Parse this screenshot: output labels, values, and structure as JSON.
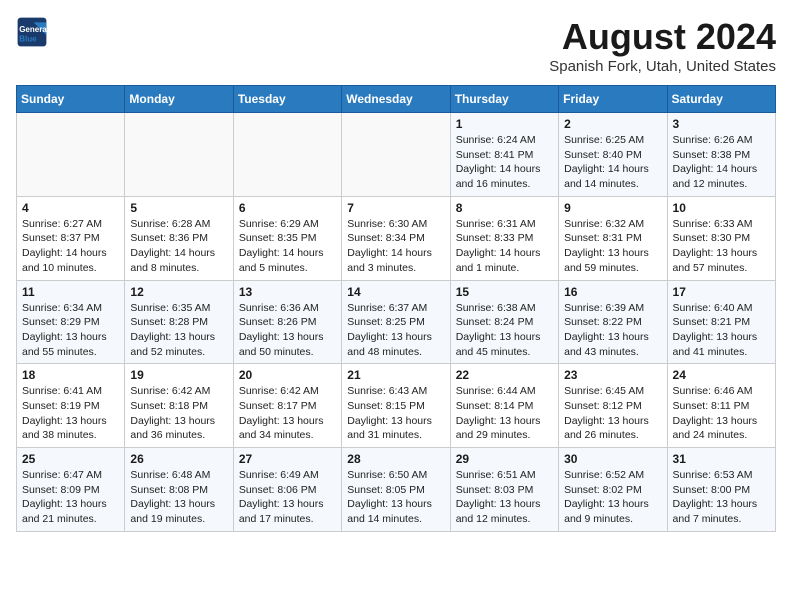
{
  "header": {
    "logo_line1": "General",
    "logo_line2": "Blue",
    "title": "August 2024",
    "subtitle": "Spanish Fork, Utah, United States"
  },
  "weekdays": [
    "Sunday",
    "Monday",
    "Tuesday",
    "Wednesday",
    "Thursday",
    "Friday",
    "Saturday"
  ],
  "weeks": [
    [
      {
        "day": "",
        "info": ""
      },
      {
        "day": "",
        "info": ""
      },
      {
        "day": "",
        "info": ""
      },
      {
        "day": "",
        "info": ""
      },
      {
        "day": "1",
        "info": "Sunrise: 6:24 AM\nSunset: 8:41 PM\nDaylight: 14 hours\nand 16 minutes."
      },
      {
        "day": "2",
        "info": "Sunrise: 6:25 AM\nSunset: 8:40 PM\nDaylight: 14 hours\nand 14 minutes."
      },
      {
        "day": "3",
        "info": "Sunrise: 6:26 AM\nSunset: 8:38 PM\nDaylight: 14 hours\nand 12 minutes."
      }
    ],
    [
      {
        "day": "4",
        "info": "Sunrise: 6:27 AM\nSunset: 8:37 PM\nDaylight: 14 hours\nand 10 minutes."
      },
      {
        "day": "5",
        "info": "Sunrise: 6:28 AM\nSunset: 8:36 PM\nDaylight: 14 hours\nand 8 minutes."
      },
      {
        "day": "6",
        "info": "Sunrise: 6:29 AM\nSunset: 8:35 PM\nDaylight: 14 hours\nand 5 minutes."
      },
      {
        "day": "7",
        "info": "Sunrise: 6:30 AM\nSunset: 8:34 PM\nDaylight: 14 hours\nand 3 minutes."
      },
      {
        "day": "8",
        "info": "Sunrise: 6:31 AM\nSunset: 8:33 PM\nDaylight: 14 hours\nand 1 minute."
      },
      {
        "day": "9",
        "info": "Sunrise: 6:32 AM\nSunset: 8:31 PM\nDaylight: 13 hours\nand 59 minutes."
      },
      {
        "day": "10",
        "info": "Sunrise: 6:33 AM\nSunset: 8:30 PM\nDaylight: 13 hours\nand 57 minutes."
      }
    ],
    [
      {
        "day": "11",
        "info": "Sunrise: 6:34 AM\nSunset: 8:29 PM\nDaylight: 13 hours\nand 55 minutes."
      },
      {
        "day": "12",
        "info": "Sunrise: 6:35 AM\nSunset: 8:28 PM\nDaylight: 13 hours\nand 52 minutes."
      },
      {
        "day": "13",
        "info": "Sunrise: 6:36 AM\nSunset: 8:26 PM\nDaylight: 13 hours\nand 50 minutes."
      },
      {
        "day": "14",
        "info": "Sunrise: 6:37 AM\nSunset: 8:25 PM\nDaylight: 13 hours\nand 48 minutes."
      },
      {
        "day": "15",
        "info": "Sunrise: 6:38 AM\nSunset: 8:24 PM\nDaylight: 13 hours\nand 45 minutes."
      },
      {
        "day": "16",
        "info": "Sunrise: 6:39 AM\nSunset: 8:22 PM\nDaylight: 13 hours\nand 43 minutes."
      },
      {
        "day": "17",
        "info": "Sunrise: 6:40 AM\nSunset: 8:21 PM\nDaylight: 13 hours\nand 41 minutes."
      }
    ],
    [
      {
        "day": "18",
        "info": "Sunrise: 6:41 AM\nSunset: 8:19 PM\nDaylight: 13 hours\nand 38 minutes."
      },
      {
        "day": "19",
        "info": "Sunrise: 6:42 AM\nSunset: 8:18 PM\nDaylight: 13 hours\nand 36 minutes."
      },
      {
        "day": "20",
        "info": "Sunrise: 6:42 AM\nSunset: 8:17 PM\nDaylight: 13 hours\nand 34 minutes."
      },
      {
        "day": "21",
        "info": "Sunrise: 6:43 AM\nSunset: 8:15 PM\nDaylight: 13 hours\nand 31 minutes."
      },
      {
        "day": "22",
        "info": "Sunrise: 6:44 AM\nSunset: 8:14 PM\nDaylight: 13 hours\nand 29 minutes."
      },
      {
        "day": "23",
        "info": "Sunrise: 6:45 AM\nSunset: 8:12 PM\nDaylight: 13 hours\nand 26 minutes."
      },
      {
        "day": "24",
        "info": "Sunrise: 6:46 AM\nSunset: 8:11 PM\nDaylight: 13 hours\nand 24 minutes."
      }
    ],
    [
      {
        "day": "25",
        "info": "Sunrise: 6:47 AM\nSunset: 8:09 PM\nDaylight: 13 hours\nand 21 minutes."
      },
      {
        "day": "26",
        "info": "Sunrise: 6:48 AM\nSunset: 8:08 PM\nDaylight: 13 hours\nand 19 minutes."
      },
      {
        "day": "27",
        "info": "Sunrise: 6:49 AM\nSunset: 8:06 PM\nDaylight: 13 hours\nand 17 minutes."
      },
      {
        "day": "28",
        "info": "Sunrise: 6:50 AM\nSunset: 8:05 PM\nDaylight: 13 hours\nand 14 minutes."
      },
      {
        "day": "29",
        "info": "Sunrise: 6:51 AM\nSunset: 8:03 PM\nDaylight: 13 hours\nand 12 minutes."
      },
      {
        "day": "30",
        "info": "Sunrise: 6:52 AM\nSunset: 8:02 PM\nDaylight: 13 hours\nand 9 minutes."
      },
      {
        "day": "31",
        "info": "Sunrise: 6:53 AM\nSunset: 8:00 PM\nDaylight: 13 hours\nand 7 minutes."
      }
    ]
  ]
}
